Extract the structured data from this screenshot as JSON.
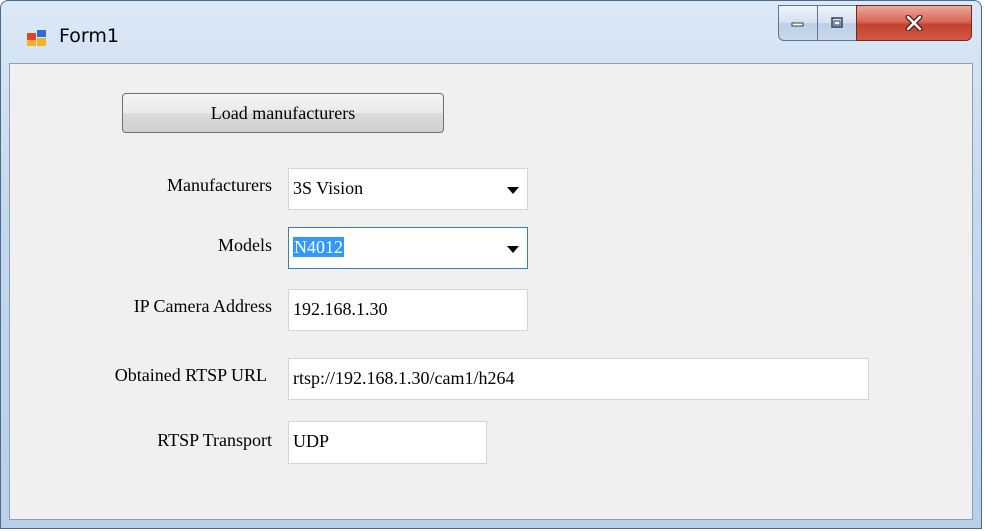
{
  "window": {
    "title": "Form1"
  },
  "buttons": {
    "load_manufacturers": "Load manufacturers"
  },
  "labels": {
    "manufacturers": "Manufacturers",
    "models": "Models",
    "ip_camera_address": "IP Camera Address",
    "obtained_rtsp_url": "Obtained RTSP URL",
    "rtsp_transport": "RTSP Transport"
  },
  "fields": {
    "manufacturers_value": "3S Vision",
    "models_value": "N4012",
    "ip_camera_address_value": "192.168.1.30",
    "obtained_rtsp_url_value": "rtsp://192.168.1.30/cam1/h264",
    "rtsp_transport_value": "UDP"
  }
}
